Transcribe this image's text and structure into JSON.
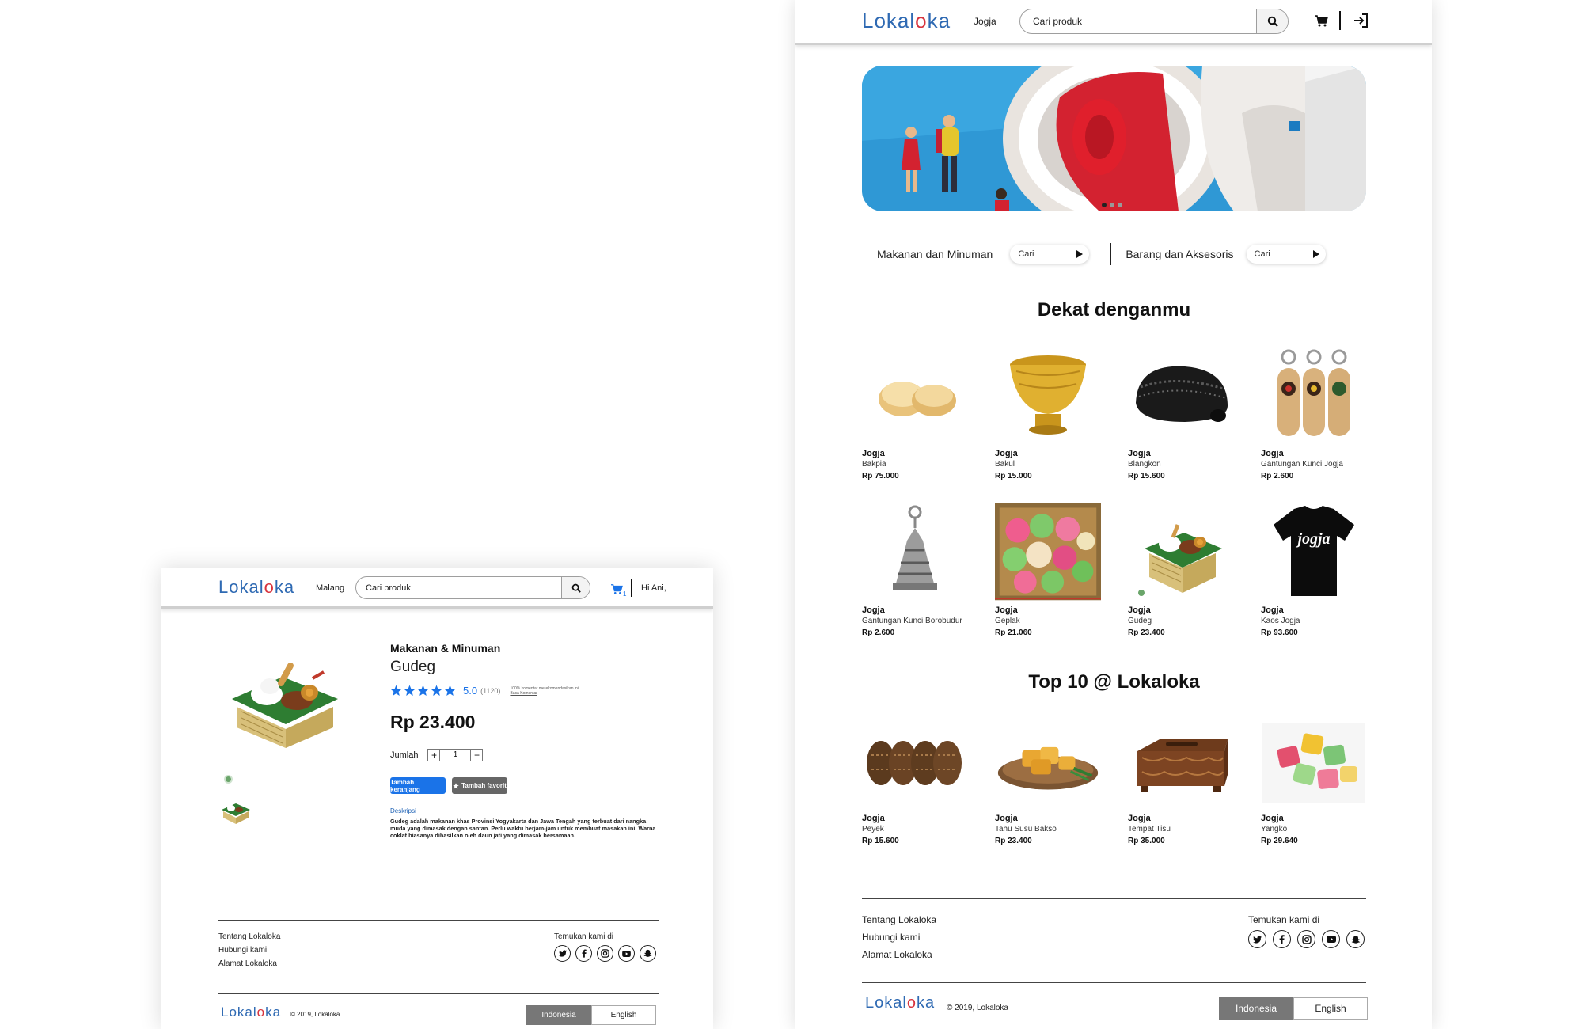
{
  "brand": {
    "part1": "Lokal",
    "part2": "o",
    "part3": "ka",
    "color_blue": "#2f6ab3",
    "color_red": "#d8333d"
  },
  "home": {
    "nav": {
      "city": "Jogja",
      "search_placeholder": "Cari produk",
      "cart_icon": "cart-icon",
      "login_icon": "login-icon"
    },
    "categories": [
      {
        "label": "Makanan dan Minuman",
        "search": "Cari"
      },
      {
        "label": "Barang dan Aksesoris",
        "search": "Cari"
      }
    ],
    "near_title": "Dekat denganmu",
    "near": [
      {
        "city": "Jogja",
        "name": "Bakpia",
        "price": "Rp 75.000"
      },
      {
        "city": "Jogja",
        "name": "Bakul",
        "price": "Rp 15.000"
      },
      {
        "city": "Jogja",
        "name": "Blangkon",
        "price": "Rp 15.600"
      },
      {
        "city": "Jogja",
        "name": "Gantungan Kunci Jogja",
        "price": "Rp 2.600"
      },
      {
        "city": "Jogja",
        "name": "Gantungan Kunci Borobudur",
        "price": "Rp 2.600"
      },
      {
        "city": "Jogja",
        "name": "Geplak",
        "price": "Rp 21.060"
      },
      {
        "city": "Jogja",
        "name": "Gudeg",
        "price": "Rp 23.400"
      },
      {
        "city": "Jogja",
        "name": "Kaos Jogja",
        "price": "Rp 93.600"
      }
    ],
    "tshirt_text": "jogja",
    "top_title": "Top 10 @ Lokaloka",
    "top": [
      {
        "city": "Jogja",
        "name": "Peyek",
        "price": "Rp 15.600"
      },
      {
        "city": "Jogja",
        "name": "Tahu Susu Bakso",
        "price": "Rp 23.400"
      },
      {
        "city": "Jogja",
        "name": "Tempat Tisu",
        "price": "Rp 35.000"
      },
      {
        "city": "Jogja",
        "name": "Yangko",
        "price": "Rp 29.640"
      }
    ]
  },
  "detail": {
    "nav": {
      "city": "Malang",
      "search_placeholder": "Cari produk",
      "cart_count": "1",
      "greeting": "Hi Ani,"
    },
    "category": "Makanan & Minuman",
    "name": "Gudeg",
    "rating": "5.0",
    "rating_count": "(1120)",
    "review_line1": "100% komentar merekomendasikan ini.",
    "review_line2": "Baca Komentar",
    "price": "Rp 23.400",
    "qty_label": "Jumlah",
    "qty_value": "1",
    "add_cart": "Tambah keranjang",
    "add_fav": "Tambah favorit",
    "desc_label": "Deskripsi",
    "desc_text": "Gudeg adalah makanan khas Provinsi Yogyakarta dan Jawa Tengah yang terbuat dari nangka muda yang dimasak dengan santan. Perlu waktu berjam-jam untuk membuat masakan ini. Warna coklat biasanya dihasilkan oleh daun jati yang dimasak bersamaan."
  },
  "footer": {
    "links": [
      "Tentang Lokaloka",
      "Hubungi kami",
      "Alamat Lokaloka"
    ],
    "social_title": "Temukan kami di",
    "social": [
      "twitter-icon",
      "facebook-icon",
      "instagram-icon",
      "youtube-icon",
      "snapchat-icon"
    ],
    "copyright": "© 2019, Lokaloka",
    "lang_active": "Indonesia",
    "lang_other": "English"
  }
}
